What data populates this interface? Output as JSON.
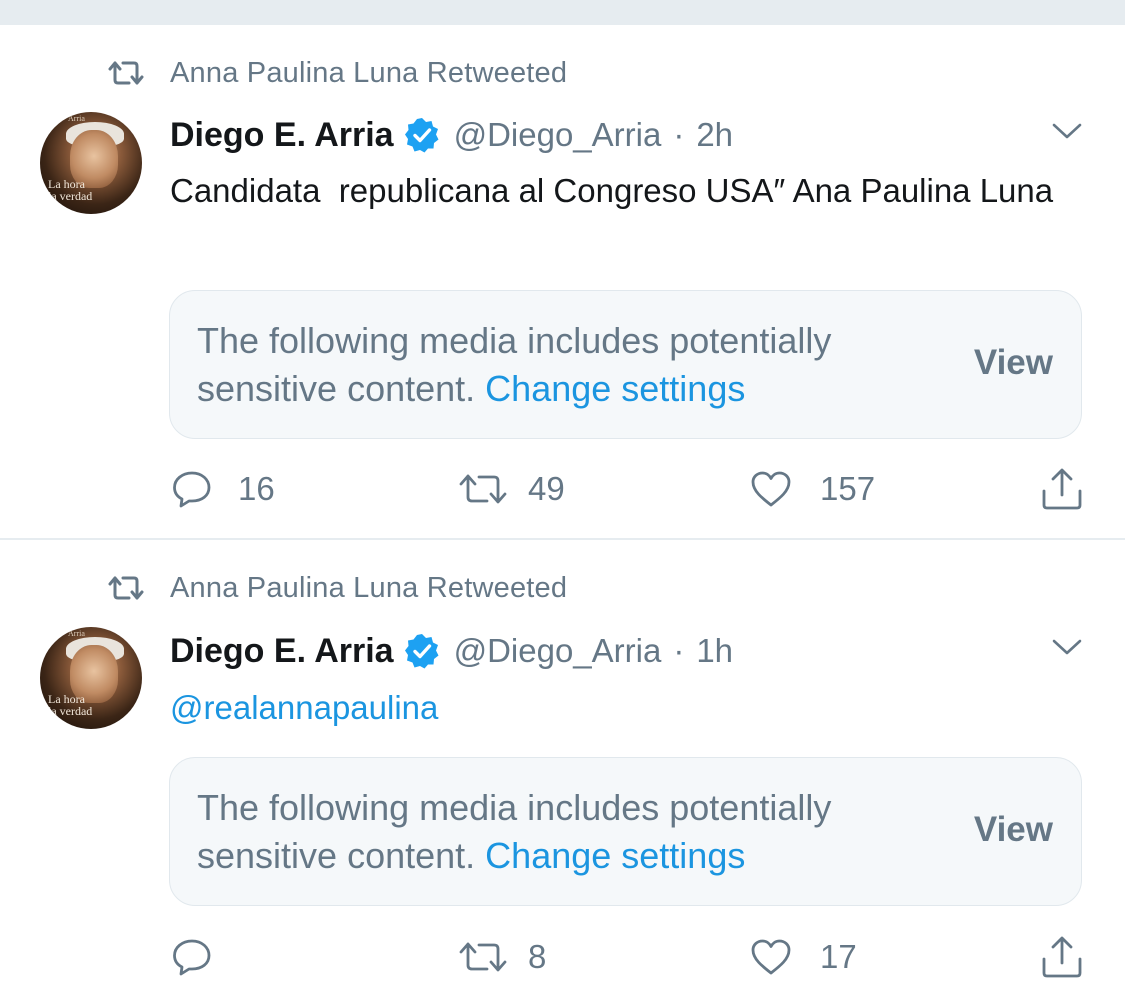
{
  "colors": {
    "accent": "#1b95e0",
    "secondary_text": "#657786",
    "primary_text": "#14171a",
    "divider": "#e6ecf0",
    "sensitive_bg": "#f5f8fa"
  },
  "tweets": [
    {
      "retweet_label": "Anna Paulina Luna Retweeted",
      "avatar": {
        "caption_top": "Arria",
        "caption_line1": "La hora",
        "caption_line2": "la verdad"
      },
      "author_name": "Diego E. Arria",
      "verified_icon": "verified-badge-icon",
      "handle": "@Diego_Arria",
      "separator": "·",
      "time": "2h",
      "text": "Candidata  republicana al Congreso USA″ Ana Paulina Luna",
      "sensitive_text": "The following media includes potentially sensitive content.",
      "sensitive_link": "Change settings",
      "view_label": "View",
      "replies": "16",
      "retweets": "49",
      "likes": "157"
    },
    {
      "retweet_label": "Anna Paulina Luna Retweeted",
      "avatar": {
        "caption_top": "Arria",
        "caption_line1": "La hora",
        "caption_line2": "la verdad"
      },
      "author_name": "Diego E. Arria",
      "verified_icon": "verified-badge-icon",
      "handle": "@Diego_Arria",
      "separator": "·",
      "time": "1h",
      "text": "@realannapaulina",
      "sensitive_text": "The following media includes potentially sensitive content.",
      "sensitive_link": "Change settings",
      "view_label": "View",
      "replies": "",
      "retweets": "8",
      "likes": "17"
    }
  ]
}
